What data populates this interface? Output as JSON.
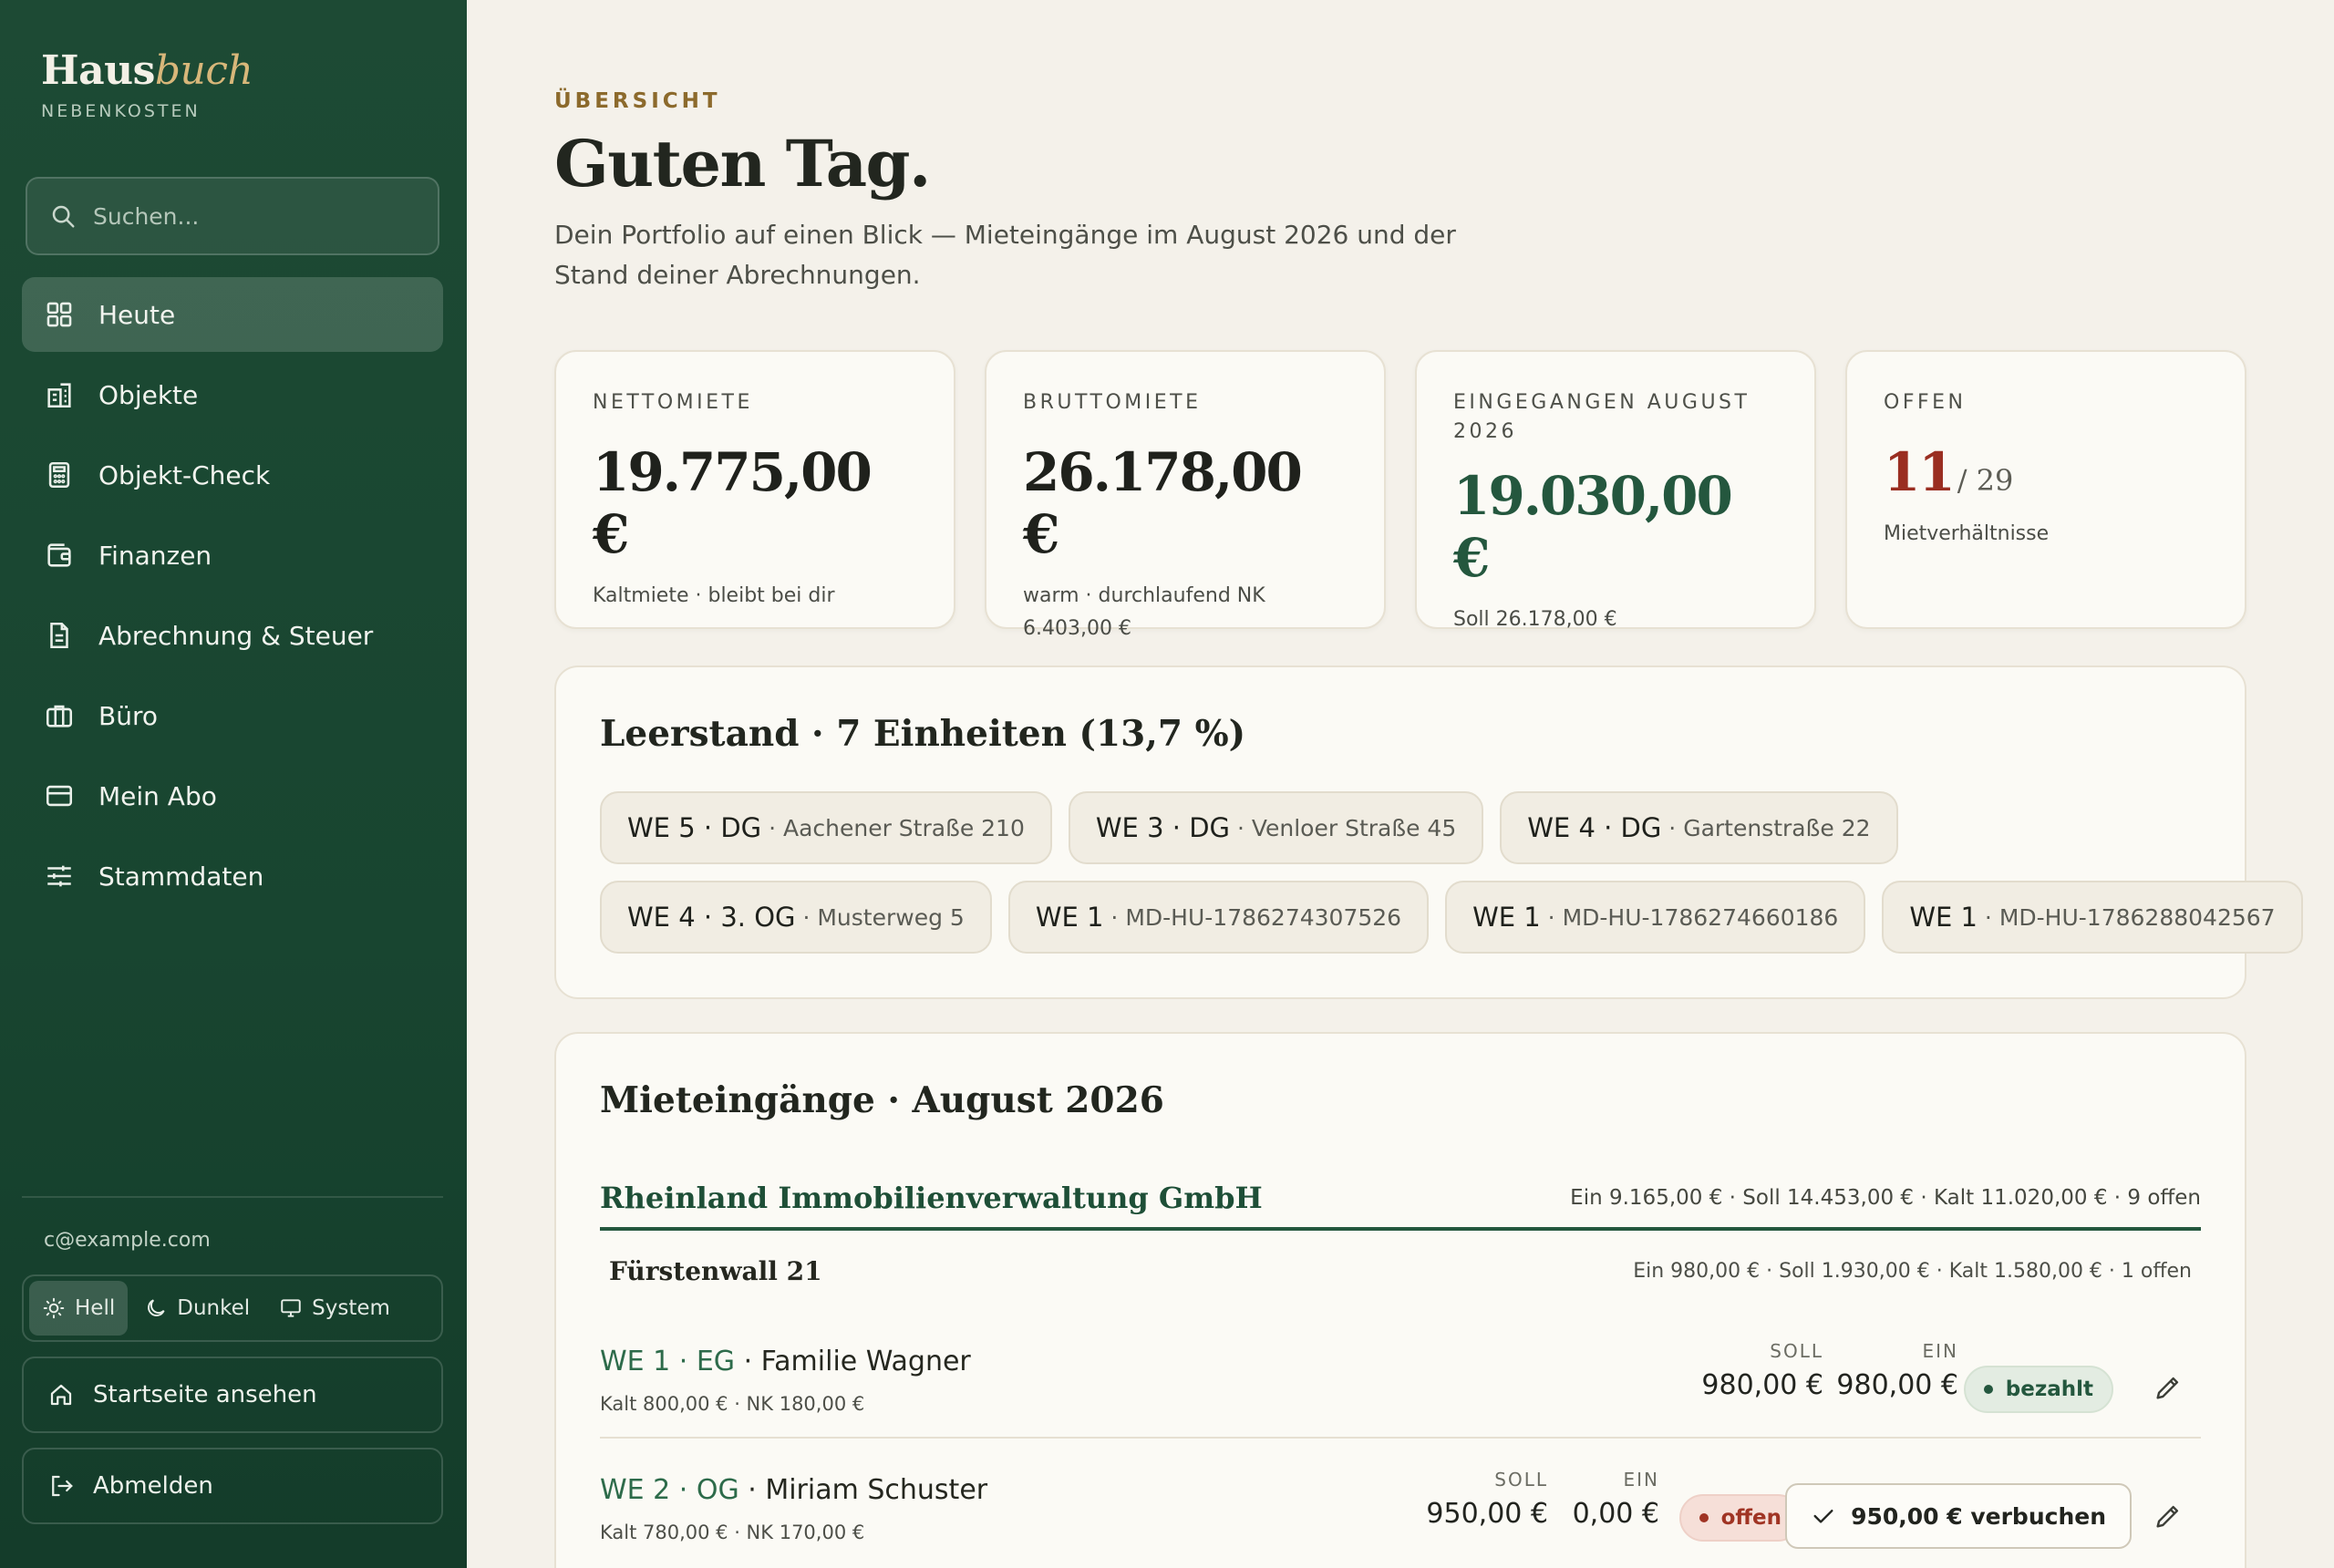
{
  "brand": {
    "title_main": "Haus",
    "title_accent": "buch",
    "subtitle": "NEBENKOSTEN"
  },
  "search": {
    "placeholder": "Suchen..."
  },
  "nav": [
    {
      "label": "Heute",
      "icon": "grid-icon",
      "active": true
    },
    {
      "label": "Objekte",
      "icon": "building-icon"
    },
    {
      "label": "Objekt-Check",
      "icon": "calculator-icon"
    },
    {
      "label": "Finanzen",
      "icon": "wallet-icon"
    },
    {
      "label": "Abrechnung & Steuer",
      "icon": "document-icon"
    },
    {
      "label": "Büro",
      "icon": "briefcase-icon"
    },
    {
      "label": "Mein Abo",
      "icon": "credit-card-icon"
    },
    {
      "label": "Stammdaten",
      "icon": "sliders-icon"
    }
  ],
  "user": {
    "email": "c@example.com"
  },
  "theme": {
    "light": "Hell",
    "dark": "Dunkel",
    "system": "System",
    "selected": "Hell"
  },
  "sidebar_buttons": {
    "home": "Startseite ansehen",
    "logout": "Abmelden"
  },
  "header": {
    "eyebrow": "ÜBERSICHT",
    "title": "Guten Tag.",
    "intro": "Dein Portfolio auf einen Blick — Mieteingänge im August 2026 und der Stand deiner Abrechnungen."
  },
  "kpis": [
    {
      "label": "NETTOMIETE",
      "value": "19.775,00 €",
      "sub": "Kaltmiete · bleibt bei dir"
    },
    {
      "label": "BRUTTOMIETE",
      "value": "26.178,00 €",
      "sub": "warm · durchlaufend NK 6.403,00 €"
    },
    {
      "label": "EINGEGANGEN AUGUST 2026",
      "value": "19.030,00 €",
      "sub": "Soll 26.178,00 €"
    },
    {
      "label": "OFFEN",
      "value": "11",
      "denom": "/ 29",
      "sub": "Mietverhältnisse"
    }
  ],
  "vacancy": {
    "title": "Leerstand · 7 Einheiten (13,7 %)",
    "units": [
      {
        "unit": "WE 5 · DG",
        "addr": "Aachener Straße 210"
      },
      {
        "unit": "WE 3 · DG",
        "addr": "Venloer Straße 45"
      },
      {
        "unit": "WE 4 · DG",
        "addr": "Gartenstraße 22"
      },
      {
        "unit": "WE 4 · 3. OG",
        "addr": "Musterweg 5"
      },
      {
        "unit": "WE 1",
        "addr": "MD-HU-1786274307526"
      },
      {
        "unit": "WE 1",
        "addr": "MD-HU-1786274660186"
      },
      {
        "unit": "WE 1",
        "addr": "MD-HU-1786288042567"
      }
    ]
  },
  "rent": {
    "title": "Mieteingänge · August 2026",
    "management": {
      "name": "Rheinland Immobilienverwaltung GmbH",
      "stats": "Ein 9.165,00 € · Soll 14.453,00 € · Kalt 11.020,00 € · 9 offen"
    },
    "property": {
      "name": "Fürstenwall 21",
      "stats": "Ein 980,00 € · Soll 1.930,00 € · Kalt 1.580,00 € · 1 offen"
    },
    "soll_label": "SOLL",
    "ein_label": "EIN",
    "tenants": [
      {
        "unit": "WE 1 · EG",
        "name": "Familie Wagner",
        "detail": "Kalt 800,00 € · NK 180,00 €",
        "soll": "980,00 €",
        "ein": "980,00 €",
        "status": "bezahlt"
      },
      {
        "unit": "WE 2 · OG",
        "name": "Miriam Schuster",
        "detail": "Kalt 780,00 € · NK 170,00 €",
        "soll": "950,00 €",
        "ein": "0,00 €",
        "status": "offen",
        "action": "950,00 € verbuchen"
      }
    ]
  },
  "colors": {
    "sidebar": "#1d4a34",
    "accent_gold": "#d8b77a",
    "green": "#24573e",
    "red": "#9a2e21",
    "background": "#f4f1ea"
  }
}
